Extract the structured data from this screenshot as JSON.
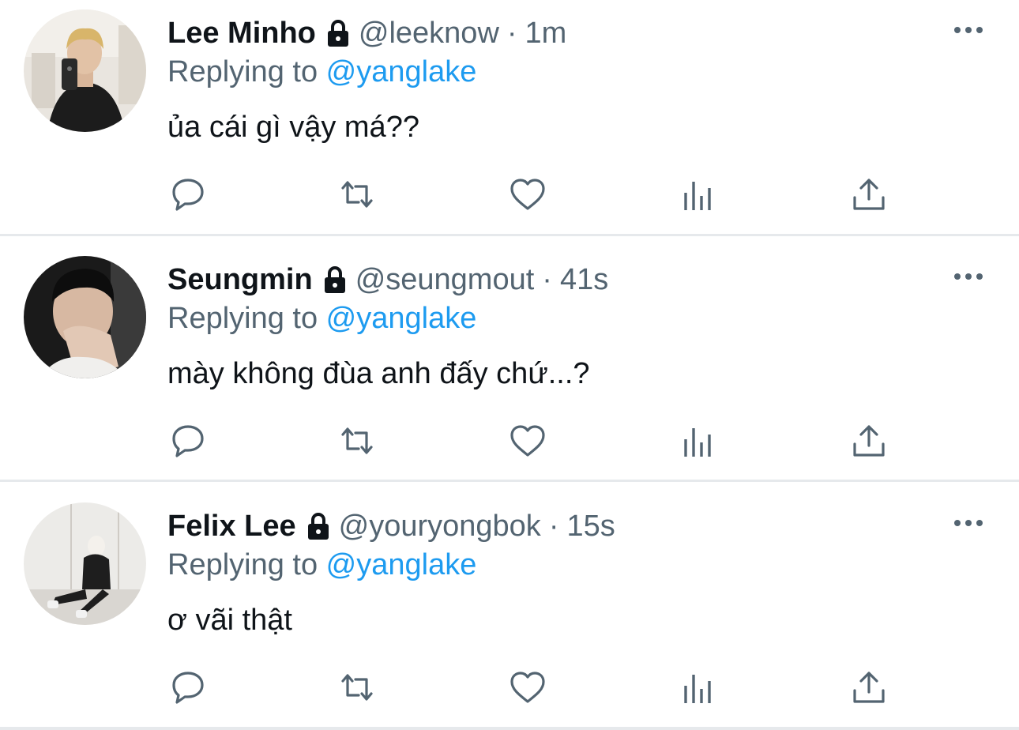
{
  "tweets": [
    {
      "display_name": "Lee Minho",
      "handle": "@leeknow",
      "separator": "·",
      "time": "1m",
      "replying_prefix": "Replying to ",
      "replying_user": "@yanglake",
      "text": "ủa cái gì vậy má??",
      "protected_icon": "lock-icon"
    },
    {
      "display_name": "Seungmin",
      "handle": "@seungmout",
      "separator": "·",
      "time": "41s",
      "replying_prefix": "Replying to ",
      "replying_user": "@yanglake",
      "text": "mày không đùa anh đấy chứ...?",
      "protected_icon": "lock-icon"
    },
    {
      "display_name": "Felix Lee",
      "handle": "@youryongbok",
      "separator": "·",
      "time": "15s",
      "replying_prefix": "Replying to ",
      "replying_user": "@yanglake",
      "text": "ơ vãi thật",
      "protected_icon": "lock-icon"
    }
  ],
  "actions": [
    "reply-icon",
    "retweet-icon",
    "like-icon",
    "analytics-icon",
    "share-icon"
  ],
  "colors": {
    "text": "#0f1419",
    "secondary": "#536471",
    "link": "#1d9bf0",
    "divider": "#e6e9ec"
  }
}
